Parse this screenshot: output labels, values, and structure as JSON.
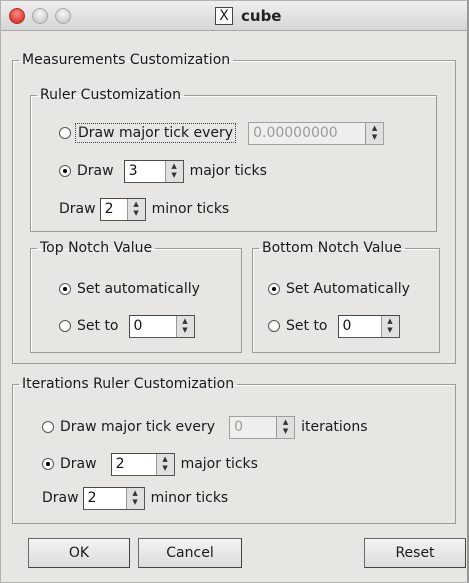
{
  "window": {
    "title": "cube",
    "title_icon_glyph": "X"
  },
  "measurements": {
    "legend": "Measurements Customization",
    "ruler": {
      "legend": "Ruler Customization",
      "every_label": "Draw major tick every",
      "every_value": "0.00000000",
      "draw_label": "Draw",
      "major_value": "3",
      "major_suffix": "major ticks",
      "minor_prefix": "Draw",
      "minor_value": "2",
      "minor_suffix": "minor ticks"
    },
    "top_notch": {
      "legend": "Top Notch Value",
      "auto_label": "Set automatically",
      "setto_label": "Set to",
      "setto_value": "0"
    },
    "bottom_notch": {
      "legend": "Bottom Notch Value",
      "auto_label": "Set Automatically",
      "setto_label": "Set to",
      "setto_value": "0"
    }
  },
  "iterations": {
    "legend": "Iterations Ruler Customization",
    "every_label": "Draw major tick every",
    "every_value": "0",
    "every_suffix": "iterations",
    "draw_label": "Draw",
    "major_value": "2",
    "major_suffix": "major ticks",
    "minor_prefix": "Draw",
    "minor_value": "2",
    "minor_suffix": "minor ticks"
  },
  "buttons": {
    "ok": "OK",
    "cancel": "Cancel",
    "reset": "Reset"
  },
  "spin_arrows": {
    "up": "▲",
    "down": "▼"
  }
}
